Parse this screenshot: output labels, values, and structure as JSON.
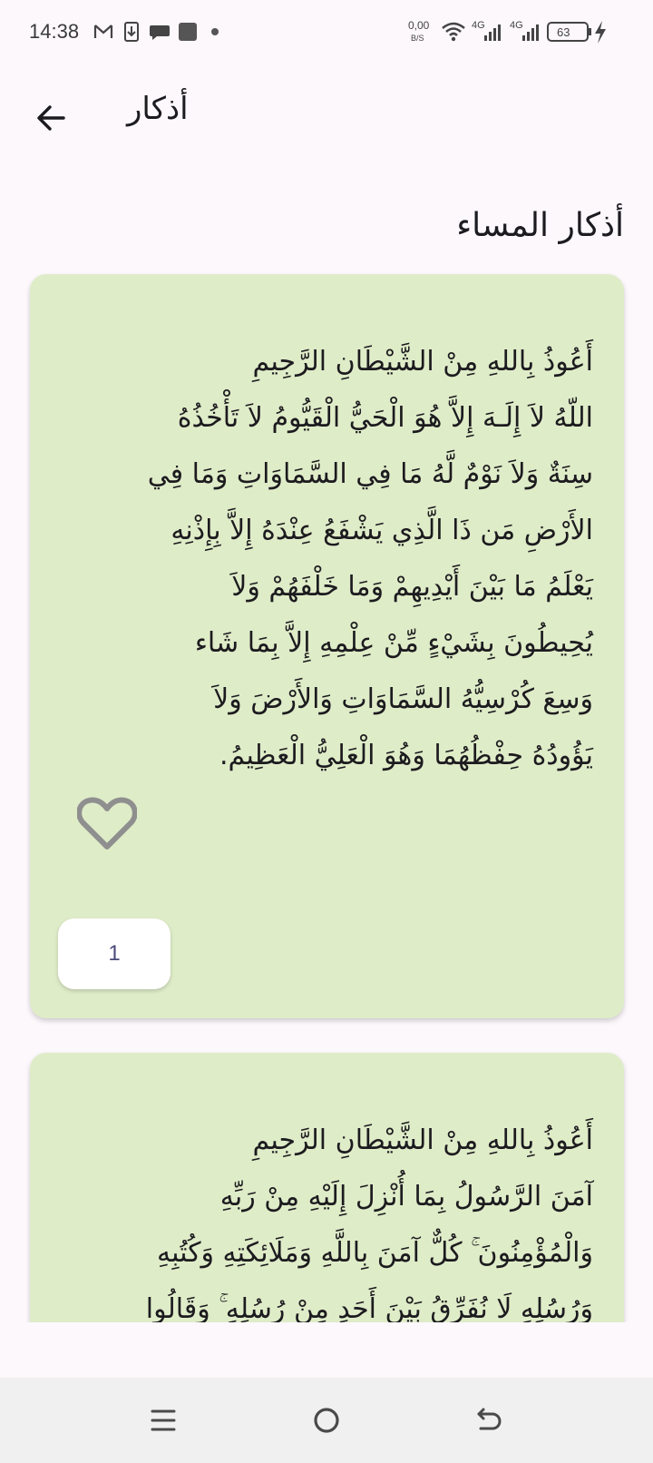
{
  "status_bar": {
    "time": "14:38",
    "net_speed_value": "0,00",
    "net_speed_unit": "B/S",
    "sim1": "4G",
    "sim2": "4G",
    "battery": "63"
  },
  "app_bar": {
    "title": "أذكار"
  },
  "section": {
    "title": "أذكار المساء"
  },
  "cards": [
    {
      "lines": [
        "أَعُوذُ بِاللهِ مِنْ الشَّيْطَانِ الرَّجِيمِ",
        "اللّهُ لاَ إِلَـهَ إِلاَّ هُوَ الْحَيُّ الْقَيُّومُ لاَ تَأْخُذُهُ",
        "سِنَةٌ وَلاَ نَوْمٌ لَّهُ مَا فِي السَّمَاوَاتِ وَمَا فِي",
        "الأَرْضِ مَن ذَا الَّذِي يَشْفَعُ عِنْدَهُ إِلاَّ بِإِذْنِهِ",
        "يَعْلَمُ مَا بَيْنَ أَيْدِيهِمْ وَمَا خَلْفَهُمْ وَلاَ",
        "يُحِيطُونَ بِشَيْءٍ مِّنْ عِلْمِهِ إِلاَّ بِمَا شَاء",
        "وَسِعَ كُرْسِيُّهُ السَّمَاوَاتِ وَالأَرْضَ وَلاَ",
        "يَؤُودُهُ حِفْظُهُمَا وَهُوَ الْعَلِيُّ الْعَظِيمُ."
      ],
      "count": "1"
    },
    {
      "lines": [
        "أَعُوذُ بِاللهِ مِنْ الشَّيْطَانِ الرَّجِيمِ",
        "آمَنَ الرَّسُولُ بِمَا أُنْزِلَ إِلَيْهِ مِنْ رَبِّهِ",
        "وَالْمُؤْمِنُونَ ۚ كُلٌّ آمَنَ بِاللَّهِ وَمَلَائِكَتِهِ وَكُتُبِهِ",
        "وَرُسُلِهِ لَا نُفَرِّقُ بَيْنَ أَحَدٍ مِنْ رُسُلِهِ ۚ وَقَالُوا"
      ]
    }
  ],
  "icons": {
    "back": "arrow-back-icon",
    "favorite": "heart-outline-icon",
    "nav_menu": "recent-apps-icon",
    "nav_home": "home-icon",
    "nav_back": "back-icon"
  },
  "colors": {
    "background": "#fcf8fc",
    "card": "#dfecc8",
    "counter_bg": "#ffffff",
    "heart": "#8f8f8f"
  }
}
